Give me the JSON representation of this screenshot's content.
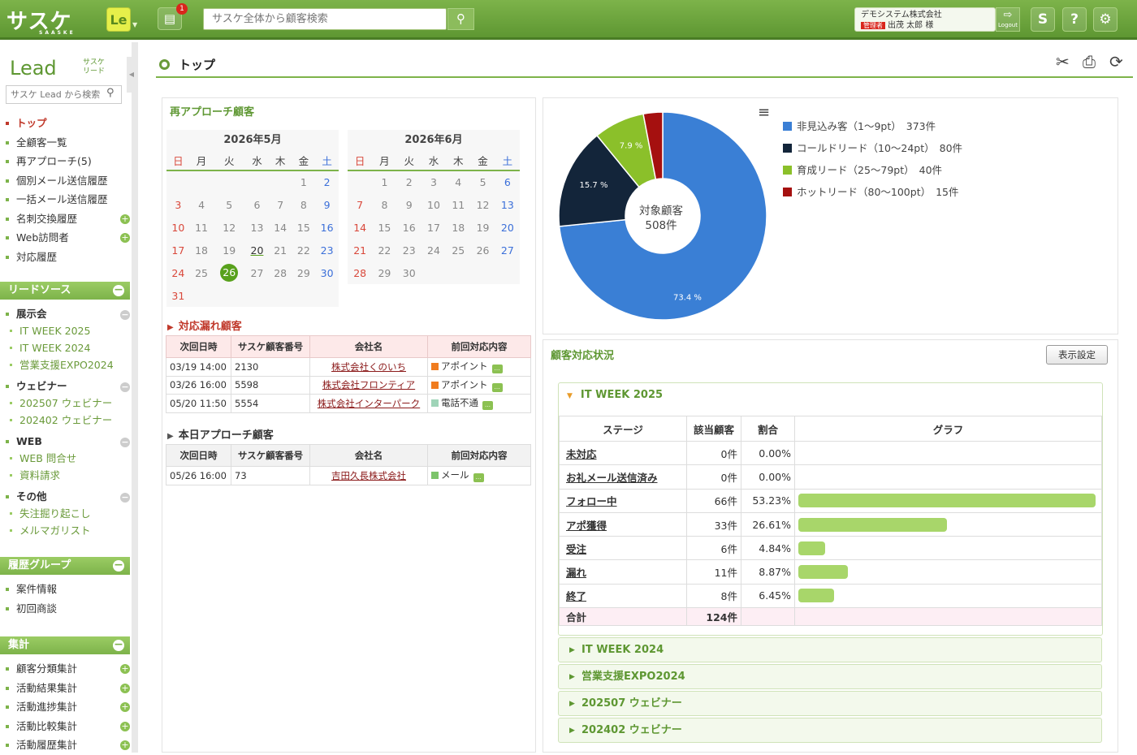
{
  "header": {
    "logo": "サスケ",
    "logo_sub": "SAASKE",
    "app_button": "Le",
    "message_count": "1",
    "search_placeholder": "サスケ全体から顧客検索",
    "company": "デモシステム株式会社",
    "role_tag": "管理者",
    "user_name": "出茂 太郎 様",
    "logout_label": "Logout"
  },
  "sidebar": {
    "logo": "Lead",
    "logo_sub": "サスケ リード",
    "search_placeholder": "サスケ Lead から検索",
    "main_items": [
      {
        "label": "トップ",
        "active": true
      },
      {
        "label": "全顧客一覧"
      },
      {
        "label": "再アプローチ(5)"
      },
      {
        "label": "個別メール送信履歴"
      },
      {
        "label": "一括メール送信履歴"
      },
      {
        "label": "名刺交換履歴",
        "plus": true
      },
      {
        "label": "Web訪問者",
        "plus": true
      },
      {
        "label": "対応履歴"
      }
    ],
    "lead_source_title": "リードソース",
    "groups": [
      {
        "label": "展示会",
        "subs": [
          "IT WEEK 2025",
          "IT WEEK 2024",
          "営業支援EXPO2024"
        ]
      },
      {
        "label": "ウェビナー",
        "subs": [
          "202507 ウェビナー",
          "202402 ウェビナー"
        ]
      },
      {
        "label": "WEB",
        "subs": [
          "WEB 問合せ",
          "資料請求"
        ]
      },
      {
        "label": "その他",
        "subs": [
          "失注掘り起こし",
          "メルマガリスト"
        ]
      }
    ],
    "history_title": "履歴グループ",
    "history_items": [
      "案件情報",
      "初回商談"
    ],
    "agg_title": "集計",
    "agg_items": [
      "顧客分類集計",
      "活動結果集計",
      "活動進捗集計",
      "活動比較集計",
      "活動履歴集計"
    ]
  },
  "page": {
    "title": "トップ"
  },
  "reapproach": {
    "title": "再アプローチ顧客",
    "weekdays": [
      "日",
      "月",
      "火",
      "水",
      "木",
      "金",
      "土"
    ],
    "may_title": "2026年5月",
    "june_title": "2026年6月",
    "may_days": [
      "",
      "",
      "",
      "",
      "",
      "1",
      "2",
      "3",
      "4",
      "5",
      "6",
      "7",
      "8",
      "9",
      "10",
      "11",
      "12",
      "13",
      "14",
      "15",
      "16",
      "17",
      "18",
      "19",
      "20",
      "21",
      "22",
      "23",
      "24",
      "25",
      "26",
      "27",
      "28",
      "29",
      "30",
      "31"
    ],
    "june_days": [
      "",
      "1",
      "2",
      "3",
      "4",
      "5",
      "6",
      "7",
      "8",
      "9",
      "10",
      "11",
      "12",
      "13",
      "14",
      "15",
      "16",
      "17",
      "18",
      "19",
      "20",
      "21",
      "22",
      "23",
      "24",
      "25",
      "26",
      "27",
      "28",
      "29",
      "30"
    ],
    "today": "26",
    "underlined": "20",
    "missed_title": "対応漏れ顧客",
    "today_title": "本日アプローチ顧客",
    "columns": [
      "次回日時",
      "サスケ顧客番号",
      "会社名",
      "前回対応内容"
    ],
    "missed_rows": [
      {
        "date": "03/19 14:00",
        "no": "2130",
        "company": "株式会社くのいち",
        "action": "アポイント",
        "color": "#f07c1f"
      },
      {
        "date": "03/26 16:00",
        "no": "5598",
        "company": "株式会社フロンティア",
        "action": "アポイント",
        "color": "#f07c1f"
      },
      {
        "date": "05/20 11:50",
        "no": "5554",
        "company": "株式会社インターパーク",
        "action": "電話不通",
        "color": "#9fd4b8"
      }
    ],
    "today_rows": [
      {
        "date": "05/26 16:00",
        "no": "73",
        "company": "吉田久長株式会社",
        "action": "メール",
        "color": "#7cc46a"
      }
    ]
  },
  "donut": {
    "center_label": "対象顧客",
    "center_value": "508件",
    "slices": [
      {
        "label": "非見込み客（1〜9pt）",
        "count": "373件",
        "pct": 73.4,
        "pct_label": "73.4 %",
        "color": "#3a7fd5"
      },
      {
        "label": "コールドリード（10〜24pt）",
        "count": "80件",
        "pct": 15.7,
        "pct_label": "15.7 %",
        "color": "#13253a"
      },
      {
        "label": "育成リード（25〜79pt）",
        "count": "40件",
        "pct": 7.9,
        "pct_label": "7.9 %",
        "color": "#8bc02a"
      },
      {
        "label": "ホットリード（80〜100pt）",
        "count": "15件",
        "pct": 3.0,
        "pct_label": "",
        "color": "#a5100f"
      }
    ]
  },
  "status": {
    "title": "顧客対応状況",
    "settings_button": "表示設定",
    "open_section": "IT WEEK 2025",
    "columns": [
      "ステージ",
      "該当顧客",
      "割合",
      "グラフ"
    ],
    "rows": [
      {
        "stage": "未対応",
        "count": "0件",
        "ratio": "0.00%",
        "pct": 0
      },
      {
        "stage": "お礼メール送信済み",
        "count": "0件",
        "ratio": "0.00%",
        "pct": 0
      },
      {
        "stage": "フォロー中",
        "count": "66件",
        "ratio": "53.23%",
        "pct": 53.23
      },
      {
        "stage": "アポ獲得",
        "count": "33件",
        "ratio": "26.61%",
        "pct": 26.61
      },
      {
        "stage": "受注",
        "count": "6件",
        "ratio": "4.84%",
        "pct": 4.84
      },
      {
        "stage": "漏れ",
        "count": "11件",
        "ratio": "8.87%",
        "pct": 8.87
      },
      {
        "stage": "終了",
        "count": "8件",
        "ratio": "6.45%",
        "pct": 6.45
      }
    ],
    "total_label": "合計",
    "total_value": "124件",
    "collapsed_sections": [
      "IT WEEK 2024",
      "営業支援EXPO2024",
      "202507 ウェビナー",
      "202402 ウェビナー"
    ]
  }
}
